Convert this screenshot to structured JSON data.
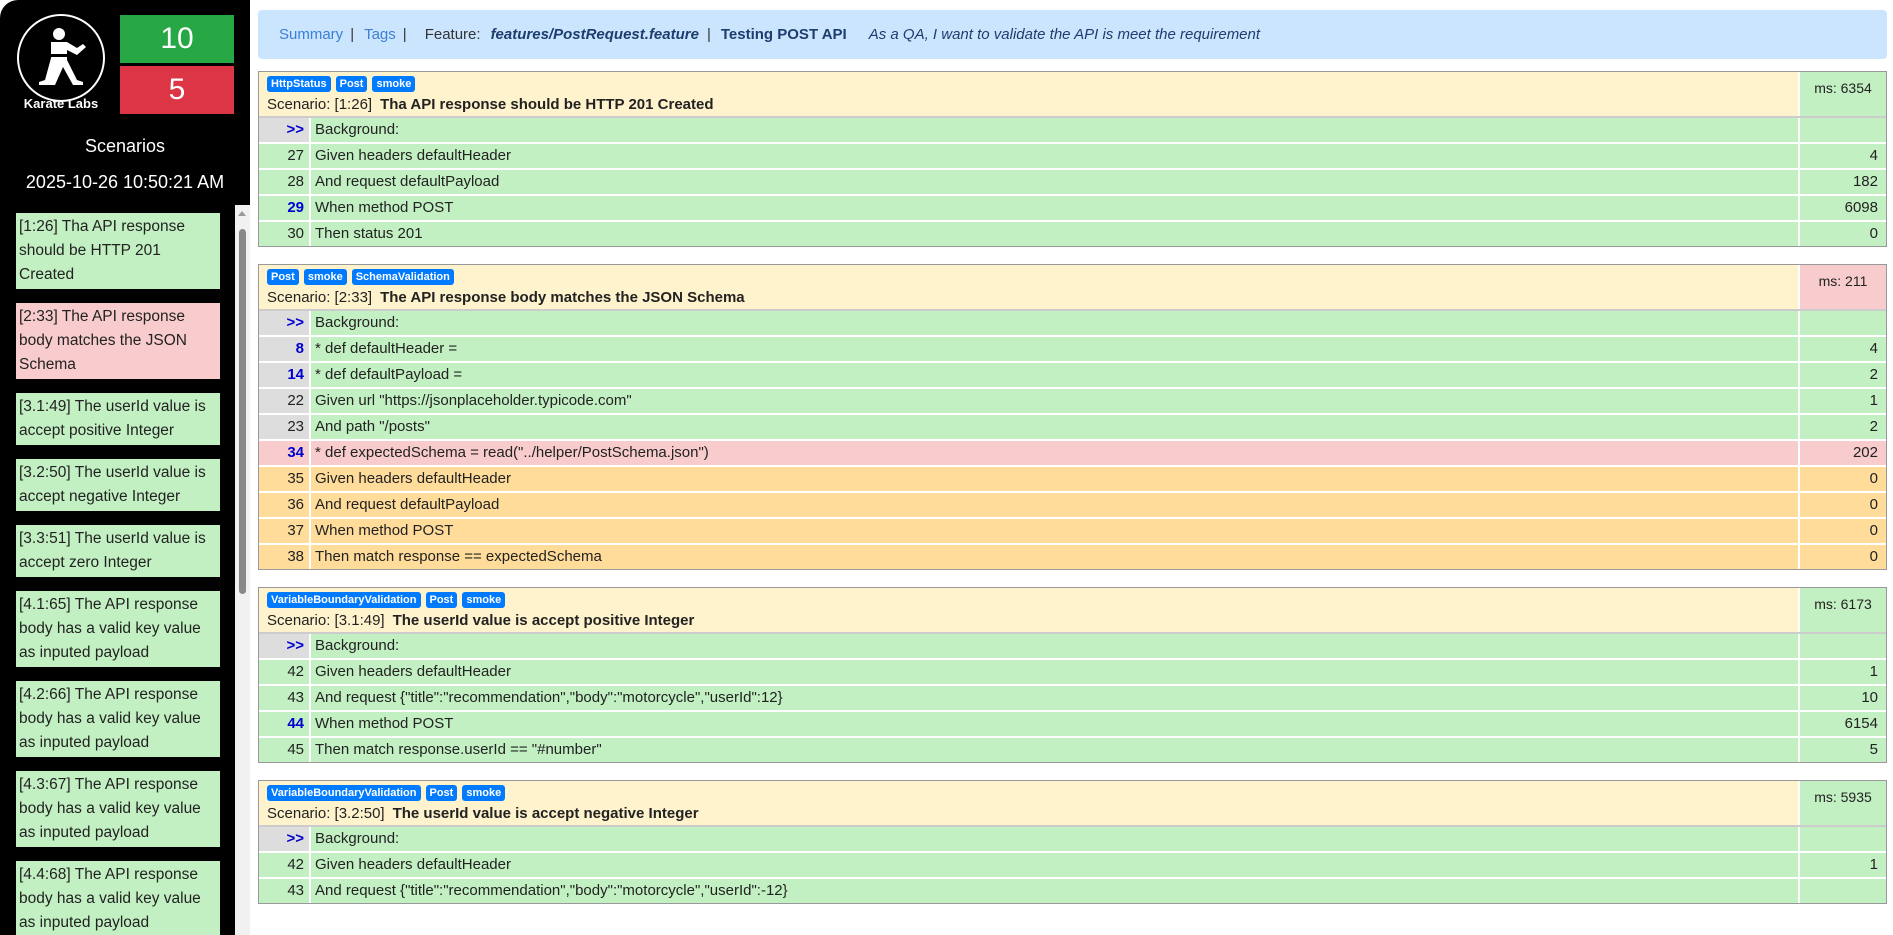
{
  "sidebar": {
    "logo_text": "Karate Labs",
    "passed_count": "10",
    "failed_count": "5",
    "label": "Scenarios",
    "date": "2025-10-26 10:50:21 AM",
    "items": [
      {
        "text": "[1:26] Tha API response should be HTTP 201 Created",
        "status": "passed"
      },
      {
        "text": "[2:33] The API response body matches the JSON Schema",
        "status": "failed"
      },
      {
        "text": "[3.1:49] The userId value is accept positive Integer",
        "status": "passed"
      },
      {
        "text": "[3.2:50] The userId value is accept negative Integer",
        "status": "passed"
      },
      {
        "text": "[3.3:51] The userId value is accept zero Integer",
        "status": "passed"
      },
      {
        "text": "[4.1:65] The API response body has a valid key value as inputed payload",
        "status": "passed"
      },
      {
        "text": "[4.2:66] The API response body has a valid key value as inputed payload",
        "status": "passed"
      },
      {
        "text": "[4.3:67] The API response body has a valid key value as inputed payload",
        "status": "passed"
      },
      {
        "text": "[4.4:68] The API response body has a valid key value as inputed payload",
        "status": "passed"
      }
    ]
  },
  "nav": {
    "summary": "Summary",
    "tags": "Tags",
    "sep": "|",
    "feature_label": "Feature:",
    "feature_path": "features/PostRequest.feature",
    "feature_title": "Testing POST API",
    "description": "As a QA, I want to validate the API is meet the requirement"
  },
  "scenario_prefix": "Scenario:",
  "scenarios": [
    {
      "tags": [
        "HttpStatus",
        "Post",
        "smoke"
      ],
      "id": "[1:26]",
      "name": "Tha API response should be HTTP 201 Created",
      "ms": "ms: 6354",
      "status": "passed",
      "steps": [
        {
          "line": ">>",
          "text": "Background:",
          "ms": "",
          "status": "passed",
          "gray": true,
          "bold": true
        },
        {
          "line": "27",
          "text": "Given headers defaultHeader",
          "ms": "4",
          "status": "passed"
        },
        {
          "line": "28",
          "text": "And request defaultPayload",
          "ms": "182",
          "status": "passed"
        },
        {
          "line": "29",
          "text": "When method POST",
          "ms": "6098",
          "status": "passed",
          "bold": true
        },
        {
          "line": "30",
          "text": "Then status 201",
          "ms": "0",
          "status": "passed"
        }
      ]
    },
    {
      "tags": [
        "Post",
        "smoke",
        "SchemaValidation"
      ],
      "id": "[2:33]",
      "name": "The API response body matches the JSON Schema",
      "ms": "ms: 211",
      "status": "failed",
      "steps": [
        {
          "line": ">>",
          "text": "Background:",
          "ms": "",
          "status": "passed",
          "gray": true,
          "bold": true
        },
        {
          "line": "8",
          "text": "* def defaultHeader =",
          "ms": "4",
          "status": "passed",
          "gray": true,
          "bold": true
        },
        {
          "line": "14",
          "text": "* def defaultPayload =",
          "ms": "2",
          "status": "passed",
          "gray": true,
          "bold": true
        },
        {
          "line": "22",
          "text": "Given url \"https://jsonplaceholder.typicode.com\"",
          "ms": "1",
          "status": "passed",
          "gray": true
        },
        {
          "line": "23",
          "text": "And path \"/posts\"",
          "ms": "2",
          "status": "passed",
          "gray": true
        },
        {
          "line": "34",
          "text": "* def expectedSchema = read(\"../helper/PostSchema.json\")",
          "ms": "202",
          "status": "failed",
          "bold": true
        },
        {
          "line": "35",
          "text": "Given headers defaultHeader",
          "ms": "0",
          "status": "skipped"
        },
        {
          "line": "36",
          "text": "And request defaultPayload",
          "ms": "0",
          "status": "skipped"
        },
        {
          "line": "37",
          "text": "When method POST",
          "ms": "0",
          "status": "skipped"
        },
        {
          "line": "38",
          "text": "Then match response == expectedSchema",
          "ms": "0",
          "status": "skipped"
        }
      ]
    },
    {
      "tags": [
        "VariableBoundaryValidation",
        "Post",
        "smoke"
      ],
      "id": "[3.1:49]",
      "name": "The userId value is accept positive Integer",
      "ms": "ms: 6173",
      "status": "passed",
      "steps": [
        {
          "line": ">>",
          "text": "Background:",
          "ms": "",
          "status": "passed",
          "gray": true,
          "bold": true
        },
        {
          "line": "42",
          "text": "Given headers defaultHeader",
          "ms": "1",
          "status": "passed"
        },
        {
          "line": "43",
          "text": "And request {\"title\":\"recommendation\",\"body\":\"motorcycle\",\"userId\":12}",
          "ms": "10",
          "status": "passed"
        },
        {
          "line": "44",
          "text": "When method POST",
          "ms": "6154",
          "status": "passed",
          "bold": true
        },
        {
          "line": "45",
          "text": "Then match response.userId == \"#number\"",
          "ms": "5",
          "status": "passed"
        }
      ]
    },
    {
      "tags": [
        "VariableBoundaryValidation",
        "Post",
        "smoke"
      ],
      "id": "[3.2:50]",
      "name": "The userId value is accept negative Integer",
      "ms": "ms: 5935",
      "status": "passed",
      "steps": [
        {
          "line": ">>",
          "text": "Background:",
          "ms": "",
          "status": "passed",
          "gray": true,
          "bold": true
        },
        {
          "line": "42",
          "text": "Given headers defaultHeader",
          "ms": "1",
          "status": "passed"
        },
        {
          "line": "43",
          "text": "And request {\"title\":\"recommendation\",\"body\":\"motorcycle\",\"userId\":-12}",
          "ms": "",
          "status": "passed"
        }
      ]
    }
  ]
}
